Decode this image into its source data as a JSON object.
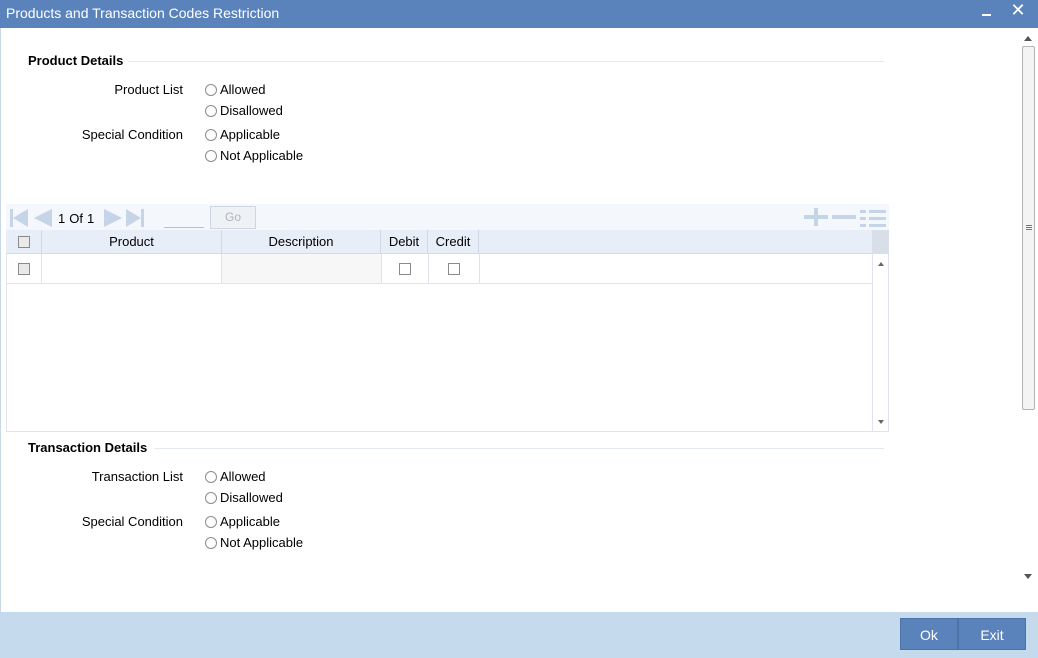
{
  "window": {
    "title": "Products and Transaction Codes Restriction",
    "close_glyph": "✕"
  },
  "product_details": {
    "section_title": "Product Details",
    "product_list": {
      "label": "Product List",
      "options": [
        "Allowed",
        "Disallowed"
      ]
    },
    "special_condition": {
      "label": "Special Condition",
      "options": [
        "Applicable",
        "Not Applicable"
      ]
    }
  },
  "grid": {
    "pagination": {
      "current_page": "1",
      "of_label": "Of",
      "total_pages": "1",
      "page_input_value": "",
      "go_label": "Go"
    },
    "columns": [
      "Product",
      "Description",
      "Debit",
      "Credit"
    ],
    "rows": [
      {
        "product": "",
        "description": "",
        "debit": false,
        "credit": false
      }
    ]
  },
  "transaction_details": {
    "section_title": "Transaction Details",
    "transaction_list": {
      "label": "Transaction List",
      "options": [
        "Allowed",
        "Disallowed"
      ]
    },
    "special_condition": {
      "label": "Special Condition",
      "options": [
        "Applicable",
        "Not Applicable"
      ]
    }
  },
  "footer": {
    "ok_label": "Ok",
    "exit_label": "Exit"
  },
  "colors": {
    "title_bar": "#5b83bb",
    "footer_bar": "#c6daee",
    "grid_header": "#e8eef7"
  }
}
